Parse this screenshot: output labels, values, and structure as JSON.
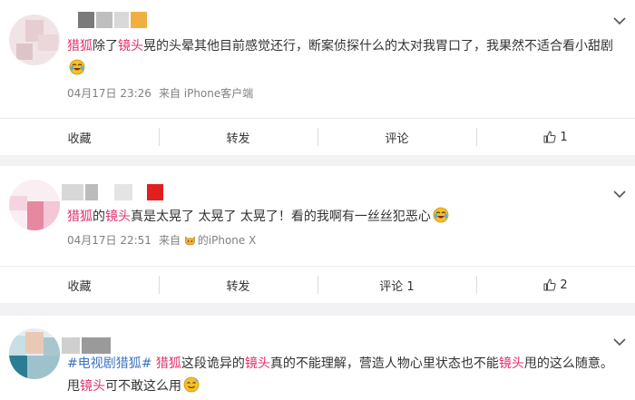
{
  "posts": [
    {
      "content": {
        "p1": "猎狐",
        "p2": "除了",
        "p3": "镜头",
        "p4": "晃的头晕其他目前感觉还行，断案侦探什么的太对我胃口了，我果然不适合看小甜剧",
        "emoji": "laugh-cry-emoji"
      },
      "time": "04月17日 23:26",
      "source": "来自 iPhone客户端",
      "actions": {
        "collect": "收藏",
        "forward": "转发",
        "comment": "评论",
        "like_count": "1"
      }
    },
    {
      "content": {
        "p1": "猎狐",
        "p2": "的",
        "p3": "镜头",
        "p4": "真是太晃了 太晃了 太晃了！看的我啊有一丝丝犯恶心",
        "emoji": "laugh-cry-emoji"
      },
      "time": "04月17日 22:51",
      "source_prefix": "来自",
      "source_suffix": "的iPhone X",
      "actions": {
        "collect": "收藏",
        "forward": "转发",
        "comment": "评论 1",
        "like_count": "2"
      }
    },
    {
      "content": {
        "tag": "#电视剧猎狐#",
        "hl1": "猎狐",
        "t1": "这段诡异的",
        "hl2": "镜头",
        "t2": "真的不能理解，营造人物心里状态也不能",
        "hl3": "镜头",
        "t3": "甩的这么随意。甩",
        "hl4": "镜头",
        "t4": "可不敢这么用",
        "emoji": "sweat-smile-emoji"
      }
    }
  ],
  "colors": {
    "highlight": "#e2306c",
    "hashtag": "#3b73c2",
    "meta": "#808080",
    "page_bg": "#f2f2f5"
  }
}
